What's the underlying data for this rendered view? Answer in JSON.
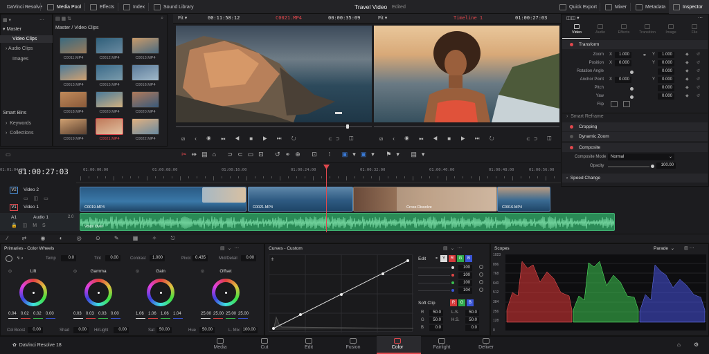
{
  "topbar": {
    "app": "DaVinci Resolve",
    "media_pool": "Media Pool",
    "effects": "Effects",
    "index": "Index",
    "sound_library": "Sound Library",
    "project_title": "Travel Video",
    "project_status": "Edited",
    "quick_export": "Quick Export",
    "mixer": "Mixer",
    "metadata": "Metadata",
    "inspector": "Inspector"
  },
  "viewer_bar": {
    "fit_left": "Fit",
    "src_timecode": "00:11:58:12",
    "src_clip": "C0021.MP4",
    "src_duration": "00:00:35:09",
    "fit_right": "Fit",
    "timeline_name": "Timeline 1",
    "rec_timecode": "01:00:27:03"
  },
  "media_tree": {
    "master": "Master",
    "items": [
      "Video Clips",
      "Audio Clips",
      "Images"
    ],
    "smart_bins": "Smart Bins",
    "smart_items": [
      "Keywords",
      "Collections"
    ]
  },
  "pool": {
    "path": "Master / Video Clips",
    "clips": [
      "C0011.MP4",
      "C0012.MP4",
      "C0013.MP4",
      "C0013.MP4",
      "C0015.MP4",
      "C0018.MP4",
      "C0018.MP4",
      "C0020.MP4",
      "C0020.MP4",
      "C0019.MP4",
      "C0021.MP4",
      "C0022.MP4"
    ]
  },
  "inspector": {
    "tabs": [
      "Video",
      "Audio",
      "Effects",
      "Transition",
      "Image",
      "File"
    ],
    "transform": "Transform",
    "zoom": "Zoom",
    "zoom_x": "1.000",
    "zoom_y": "1.000",
    "position": "Position",
    "pos_x": "0.000",
    "pos_y": "0.000",
    "rotation": "Rotation Angle",
    "rot_val": "0.000",
    "anchor": "Anchor Point",
    "anchor_x": "0.000",
    "anchor_y": "0.000",
    "pitch": "Pitch",
    "pitch_val": "0.000",
    "yaw": "Yaw",
    "yaw_val": "0.000",
    "flip": "Flip",
    "smart_reframe": "Smart Reframe",
    "cropping": "Cropping",
    "dynamic_zoom": "Dynamic Zoom",
    "composite": "Composite",
    "composite_mode": "Composite Mode",
    "mode_val": "Normal",
    "opacity": "Opacity",
    "opacity_val": "100.00",
    "speed_change": "Speed Change",
    "x": "X",
    "y": "Y"
  },
  "timeline": {
    "timecode": "01:00:27:03",
    "ruler": [
      "01:00:00:00",
      "01:00:08:00",
      "01:00:16:00",
      "01:00:24:00",
      "01:00:32:00",
      "01:00:40:00",
      "01:00:48:00",
      "01:00:56:00",
      "01:01:04:00"
    ],
    "tracks": {
      "v2": "V2",
      "v2_name": "Video 2",
      "v1": "V1",
      "v1_name": "Video 1",
      "a1": "A1",
      "a1_name": "Audio 1",
      "a1_num": "2.0"
    },
    "clips": {
      "c1": "C0019.MP4",
      "c2": "C0021.MP4",
      "dissolve": "Cross Dissolve",
      "c3": "C0016.MP4",
      "audio": "Voice Over"
    }
  },
  "color": {
    "title": "Primaries - Color Wheels",
    "temp": "Temp",
    "temp_val": "0.0",
    "tint": "Tint",
    "tint_val": "0.00",
    "contrast": "Contrast",
    "contrast_val": "1.000",
    "pivot": "Pivot",
    "pivot_val": "0.435",
    "middetail": "Mid/Detail",
    "middetail_val": "0.00",
    "wheels": [
      {
        "name": "Lift",
        "vals": [
          "0.04",
          "0.02",
          "0.02",
          "0.00"
        ]
      },
      {
        "name": "Gamma",
        "vals": [
          "0.03",
          "0.03",
          "0.03",
          "0.00"
        ]
      },
      {
        "name": "Gain",
        "vals": [
          "1.06",
          "1.06",
          "1.06",
          "1.04"
        ]
      },
      {
        "name": "Offset",
        "vals": [
          "25.00",
          "25.00",
          "25.00",
          "25.00"
        ]
      }
    ],
    "colboost": "Col Boost",
    "colboost_val": "0.00",
    "shad": "Shad",
    "shad_val": "0.00",
    "hilight": "Hi/Light",
    "hilight_val": "0.00",
    "sat": "Sat",
    "sat_val": "50.00",
    "hue": "Hue",
    "hue_val": "50.00",
    "lmix": "L. Mix",
    "lmix_val": "100.00"
  },
  "curves": {
    "title": "Curves - Custom",
    "edit": "Edit",
    "edit_vals": [
      "100",
      "100",
      "100",
      "104"
    ],
    "softclip": "Soft Clip",
    "r": "R",
    "g": "G",
    "b": "B",
    "r_val": "50.0",
    "g_val": "50.0",
    "b_val": "0.0",
    "ls": "L.S.",
    "hs": "H.S.",
    "ls_val": "50.0",
    "hs_val": "50.0",
    "hs2_val": "0.0",
    "y": "Y",
    "rr": "R",
    "gg": "G",
    "bb": "B"
  },
  "scopes": {
    "title": "Scopes",
    "mode": "Parade",
    "ticks": [
      "1023",
      "896",
      "768",
      "640",
      "512",
      "384",
      "256",
      "128",
      "0"
    ]
  },
  "nav": {
    "brand": "DaVinci Resolve 18",
    "items": [
      "Media",
      "Cut",
      "Edit",
      "Fusion",
      "Color",
      "Fairlight",
      "Deliver"
    ]
  },
  "colors": {
    "accent": "#e0484d",
    "clip_blue": "#2f5f8a",
    "audio_green": "#2e9a5a",
    "red": "#e04545",
    "green": "#3bbf4f",
    "blue": "#3a55d6"
  }
}
